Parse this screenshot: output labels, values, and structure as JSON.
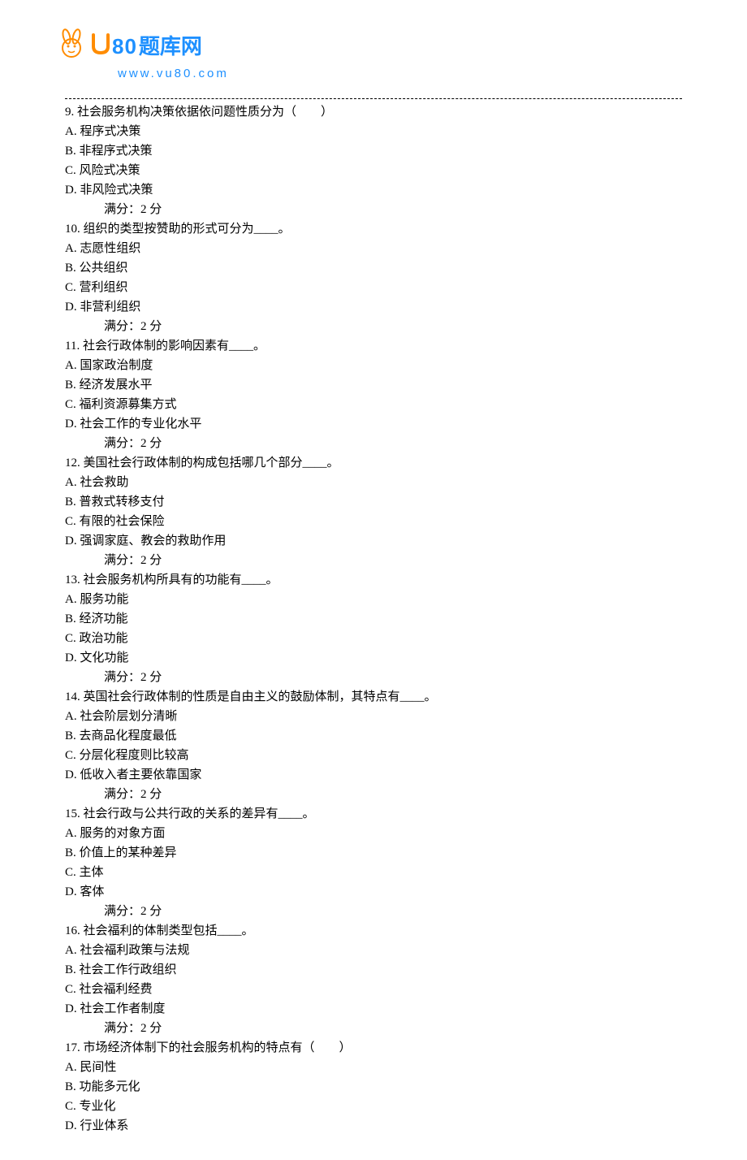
{
  "logo": {
    "brand_number": "80",
    "brand_text": "题库网",
    "url": "www.vu80.com"
  },
  "questions": [
    {
      "number": "9.",
      "text": "社会服务机构决策依据依问题性质分为（　　）",
      "options": [
        "A.  程序式决策",
        "B.  非程序式决策",
        "C.  风险式决策",
        "D.  非风险式决策"
      ],
      "score": "满分：2   分"
    },
    {
      "number": "10.",
      "text": "组织的类型按赞助的形式可分为____。",
      "options": [
        "A.  志愿性组织",
        "B.  公共组织",
        "C.  营利组织",
        "D.  非营利组织"
      ],
      "score": "满分：2   分"
    },
    {
      "number": "11.",
      "text": "社会行政体制的影响因素有____。",
      "options": [
        "A.  国家政治制度",
        "B.  经济发展水平",
        "C.  福利资源募集方式",
        "D.  社会工作的专业化水平"
      ],
      "score": "满分：2   分"
    },
    {
      "number": "12.",
      "text": "美国社会行政体制的构成包括哪几个部分____。",
      "options": [
        "A.  社会救助",
        "B.  普救式转移支付",
        "C.  有限的社会保险",
        "D.  强调家庭、教会的救助作用"
      ],
      "score": "满分：2   分"
    },
    {
      "number": "13.",
      "text": "社会服务机构所具有的功能有____。",
      "options": [
        "A.  服务功能",
        "B.  经济功能",
        "C.  政治功能",
        "D.  文化功能"
      ],
      "score": "满分：2   分"
    },
    {
      "number": "14.",
      "text": "英国社会行政体制的性质是自由主义的鼓励体制，其特点有____。",
      "options": [
        "A.  社会阶层划分清晰",
        "B.  去商品化程度最低",
        "C.  分层化程度则比较高",
        "D.  低收入者主要依靠国家"
      ],
      "score": "满分：2   分"
    },
    {
      "number": "15.",
      "text": "社会行政与公共行政的关系的差异有____。",
      "options": [
        "A.  服务的对象方面",
        "B.  价值上的某种差异",
        "C.  主体",
        "D.  客体"
      ],
      "score": "满分：2   分"
    },
    {
      "number": "16.",
      "text": "社会福利的体制类型包括____。",
      "options": [
        "A.  社会福利政策与法规",
        "B.  社会工作行政组织",
        "C.  社会福利经费",
        "D.  社会工作者制度"
      ],
      "score": "满分：2   分"
    },
    {
      "number": "17.",
      "text": "市场经济体制下的社会服务机构的特点有（　　）",
      "options": [
        "A.  民间性",
        "B.  功能多元化",
        "C.  专业化",
        "D.  行业体系"
      ],
      "score": ""
    }
  ]
}
